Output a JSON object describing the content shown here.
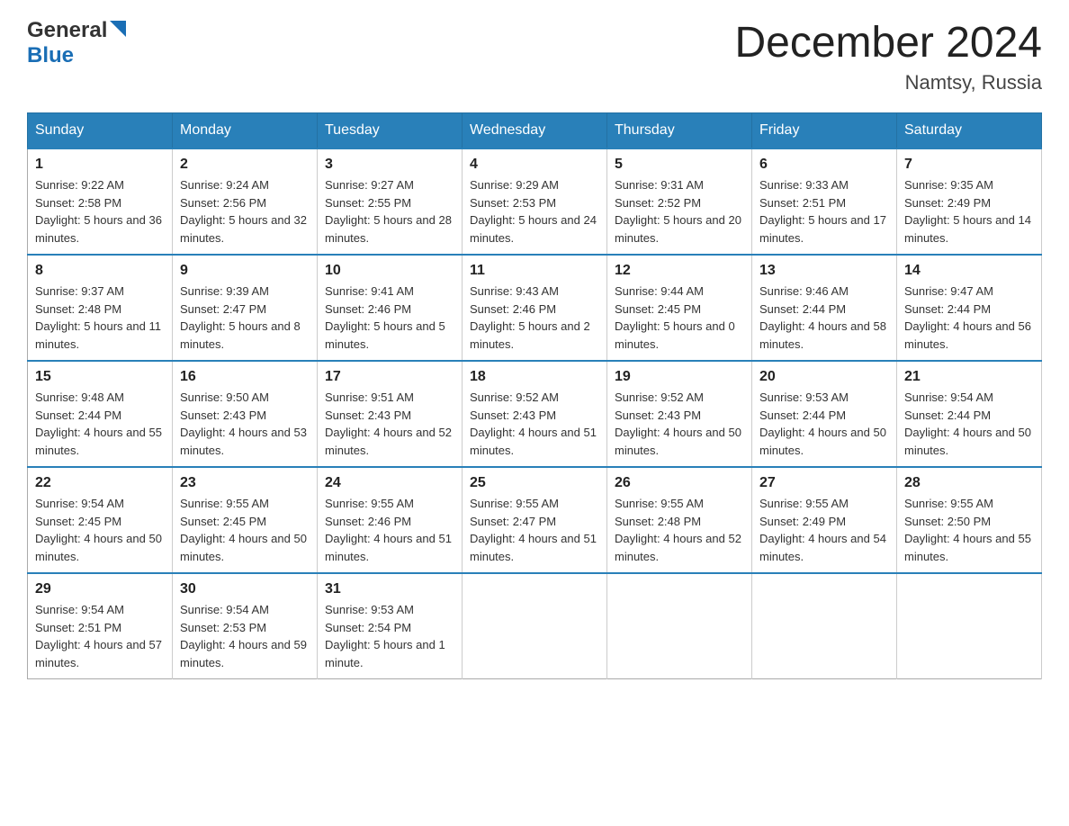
{
  "header": {
    "logo_general": "General",
    "logo_blue": "Blue",
    "title": "December 2024",
    "subtitle": "Namtsy, Russia"
  },
  "columns": [
    "Sunday",
    "Monday",
    "Tuesday",
    "Wednesday",
    "Thursday",
    "Friday",
    "Saturday"
  ],
  "weeks": [
    [
      {
        "day": "1",
        "sunrise": "9:22 AM",
        "sunset": "2:58 PM",
        "daylight": "5 hours and 36 minutes."
      },
      {
        "day": "2",
        "sunrise": "9:24 AM",
        "sunset": "2:56 PM",
        "daylight": "5 hours and 32 minutes."
      },
      {
        "day": "3",
        "sunrise": "9:27 AM",
        "sunset": "2:55 PM",
        "daylight": "5 hours and 28 minutes."
      },
      {
        "day": "4",
        "sunrise": "9:29 AM",
        "sunset": "2:53 PM",
        "daylight": "5 hours and 24 minutes."
      },
      {
        "day": "5",
        "sunrise": "9:31 AM",
        "sunset": "2:52 PM",
        "daylight": "5 hours and 20 minutes."
      },
      {
        "day": "6",
        "sunrise": "9:33 AM",
        "sunset": "2:51 PM",
        "daylight": "5 hours and 17 minutes."
      },
      {
        "day": "7",
        "sunrise": "9:35 AM",
        "sunset": "2:49 PM",
        "daylight": "5 hours and 14 minutes."
      }
    ],
    [
      {
        "day": "8",
        "sunrise": "9:37 AM",
        "sunset": "2:48 PM",
        "daylight": "5 hours and 11 minutes."
      },
      {
        "day": "9",
        "sunrise": "9:39 AM",
        "sunset": "2:47 PM",
        "daylight": "5 hours and 8 minutes."
      },
      {
        "day": "10",
        "sunrise": "9:41 AM",
        "sunset": "2:46 PM",
        "daylight": "5 hours and 5 minutes."
      },
      {
        "day": "11",
        "sunrise": "9:43 AM",
        "sunset": "2:46 PM",
        "daylight": "5 hours and 2 minutes."
      },
      {
        "day": "12",
        "sunrise": "9:44 AM",
        "sunset": "2:45 PM",
        "daylight": "5 hours and 0 minutes."
      },
      {
        "day": "13",
        "sunrise": "9:46 AM",
        "sunset": "2:44 PM",
        "daylight": "4 hours and 58 minutes."
      },
      {
        "day": "14",
        "sunrise": "9:47 AM",
        "sunset": "2:44 PM",
        "daylight": "4 hours and 56 minutes."
      }
    ],
    [
      {
        "day": "15",
        "sunrise": "9:48 AM",
        "sunset": "2:44 PM",
        "daylight": "4 hours and 55 minutes."
      },
      {
        "day": "16",
        "sunrise": "9:50 AM",
        "sunset": "2:43 PM",
        "daylight": "4 hours and 53 minutes."
      },
      {
        "day": "17",
        "sunrise": "9:51 AM",
        "sunset": "2:43 PM",
        "daylight": "4 hours and 52 minutes."
      },
      {
        "day": "18",
        "sunrise": "9:52 AM",
        "sunset": "2:43 PM",
        "daylight": "4 hours and 51 minutes."
      },
      {
        "day": "19",
        "sunrise": "9:52 AM",
        "sunset": "2:43 PM",
        "daylight": "4 hours and 50 minutes."
      },
      {
        "day": "20",
        "sunrise": "9:53 AM",
        "sunset": "2:44 PM",
        "daylight": "4 hours and 50 minutes."
      },
      {
        "day": "21",
        "sunrise": "9:54 AM",
        "sunset": "2:44 PM",
        "daylight": "4 hours and 50 minutes."
      }
    ],
    [
      {
        "day": "22",
        "sunrise": "9:54 AM",
        "sunset": "2:45 PM",
        "daylight": "4 hours and 50 minutes."
      },
      {
        "day": "23",
        "sunrise": "9:55 AM",
        "sunset": "2:45 PM",
        "daylight": "4 hours and 50 minutes."
      },
      {
        "day": "24",
        "sunrise": "9:55 AM",
        "sunset": "2:46 PM",
        "daylight": "4 hours and 51 minutes."
      },
      {
        "day": "25",
        "sunrise": "9:55 AM",
        "sunset": "2:47 PM",
        "daylight": "4 hours and 51 minutes."
      },
      {
        "day": "26",
        "sunrise": "9:55 AM",
        "sunset": "2:48 PM",
        "daylight": "4 hours and 52 minutes."
      },
      {
        "day": "27",
        "sunrise": "9:55 AM",
        "sunset": "2:49 PM",
        "daylight": "4 hours and 54 minutes."
      },
      {
        "day": "28",
        "sunrise": "9:55 AM",
        "sunset": "2:50 PM",
        "daylight": "4 hours and 55 minutes."
      }
    ],
    [
      {
        "day": "29",
        "sunrise": "9:54 AM",
        "sunset": "2:51 PM",
        "daylight": "4 hours and 57 minutes."
      },
      {
        "day": "30",
        "sunrise": "9:54 AM",
        "sunset": "2:53 PM",
        "daylight": "4 hours and 59 minutes."
      },
      {
        "day": "31",
        "sunrise": "9:53 AM",
        "sunset": "2:54 PM",
        "daylight": "5 hours and 1 minute."
      },
      null,
      null,
      null,
      null
    ]
  ],
  "labels": {
    "sunrise": "Sunrise:",
    "sunset": "Sunset:",
    "daylight": "Daylight:"
  }
}
